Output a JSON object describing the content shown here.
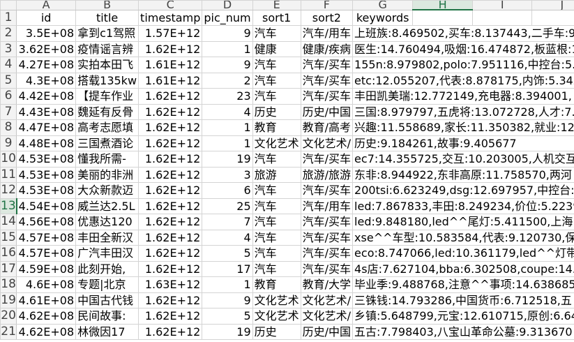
{
  "columns": [
    "A",
    "B",
    "C",
    "D",
    "E",
    "F",
    "G",
    "H",
    "I",
    "J"
  ],
  "selected_column": "H",
  "header_row": {
    "row_num": "1",
    "id": "id",
    "title": "title",
    "timestamp": "timestamp",
    "pic_num": "pic_num",
    "sort1": "sort1",
    "sort2": "sort2",
    "keywords": "keywords"
  },
  "rows": [
    {
      "row_num": "2",
      "id": "3.5E+08",
      "title": "拿到c1驾照",
      "timestamp": "1.57E+12",
      "pic_num": "9",
      "sort1": "汽车",
      "sort2": "汽车/用车",
      "keywords": "上班族:8.469502,买车:8.137443,二手车:9."
    },
    {
      "row_num": "3",
      "id": "3.62E+08",
      "title": "疫情谣言辨",
      "timestamp": "1.62E+12",
      "pic_num": "1",
      "sort1": "健康",
      "sort2": "健康/疾病",
      "keywords": "医生:14.760494,吸烟:16.474872,板蓝根:1"
    },
    {
      "row_num": "4",
      "id": "4.27E+08",
      "title": "实拍本田飞",
      "timestamp": "1.61E+12",
      "pic_num": "9",
      "sort1": "汽车",
      "sort2": "汽车/买车",
      "keywords": "155n:8.979802,polo:7.951116,中控台:5.9"
    },
    {
      "row_num": "5",
      "id": "4.3E+08",
      "title": "搭载135kw",
      "timestamp": "1.61E+12",
      "pic_num": "2",
      "sort1": "汽车",
      "sort2": "汽车/买车",
      "keywords": "etc:12.055207,代表:8.878175,内饰:5.3420"
    },
    {
      "row_num": "6",
      "id": "4.42E+08",
      "title": "【提车作业",
      "timestamp": "1.62E+12",
      "pic_num": "23",
      "sort1": "汽车",
      "sort2": "汽车/买车",
      "keywords": "丰田凯美瑞:12.772149,充电器:8.394001,"
    },
    {
      "row_num": "7",
      "id": "4.43E+08",
      "title": "魏延有反骨",
      "timestamp": "1.62E+12",
      "pic_num": "4",
      "sort1": "历史",
      "sort2": "历史/中国",
      "keywords": "三国:8.979797,五虎将:13.072728,人才:7."
    },
    {
      "row_num": "8",
      "id": "4.47E+08",
      "title": "高考志愿填",
      "timestamp": "1.62E+12",
      "pic_num": "1",
      "sort1": "教育",
      "sort2": "教育/高考",
      "keywords": "兴趣:11.558689,家长:11.350382,就业:12."
    },
    {
      "row_num": "9",
      "id": "4.48E+08",
      "title": "三国煮酒论",
      "timestamp": "1.62E+12",
      "pic_num": "1",
      "sort1": "文化艺术",
      "sort2": "文化艺术/",
      "keywords": "历史:9.184261,故事:9.405677"
    },
    {
      "row_num": "10",
      "id": "4.53E+08",
      "title": "懂我所需-",
      "timestamp": "1.62E+12",
      "pic_num": "19",
      "sort1": "汽车",
      "sort2": "汽车/买车",
      "keywords": "ec7:14.355725,交互:10.203005,人机交互"
    },
    {
      "row_num": "11",
      "id": "4.53E+08",
      "title": "美丽的非洲",
      "timestamp": "1.62E+12",
      "pic_num": "3",
      "sort1": "旅游",
      "sort2": "旅游/旅游",
      "keywords": "东非:8.944922,东非高原:11.758570,两河"
    },
    {
      "row_num": "12",
      "id": "4.53E+08",
      "title": "大众新款迈",
      "timestamp": "1.62E+12",
      "pic_num": "6",
      "sort1": "汽车",
      "sort2": "汽车/买车",
      "keywords": "200tsi:6.623249,dsg:12.697957,中控台:8."
    },
    {
      "row_num": "13",
      "id": "4.54E+08",
      "title": "威兰达2.5L",
      "timestamp": "1.62E+12",
      "pic_num": "25",
      "sort1": "汽车",
      "sort2": "汽车/用车",
      "keywords": "led:7.867833,丰田:8.249234,价位:5.22396"
    },
    {
      "row_num": "14",
      "id": "4.56E+08",
      "title": "优惠达120",
      "timestamp": "1.62E+12",
      "pic_num": "7",
      "sort1": "汽车",
      "sort2": "汽车/买车",
      "keywords": "led:9.848180,led^^尾灯:5.411500,上海:7."
    },
    {
      "row_num": "15",
      "id": "4.57E+08",
      "title": "丰田全新汉",
      "timestamp": "1.62E+12",
      "pic_num": "4",
      "sort1": "汽车",
      "sort2": "汽车/买车",
      "keywords": "xse^^车型:10.583584,代表:9.120730,保险"
    },
    {
      "row_num": "16",
      "id": "4.57E+08",
      "title": "广汽丰田汉",
      "timestamp": "1.62E+12",
      "pic_num": "5",
      "sort1": "汽车",
      "sort2": "汽车/买车",
      "keywords": "eco:8.747066,led:10.361179,led^^灯带:1"
    },
    {
      "row_num": "17",
      "id": "4.59E+08",
      "title": "此刻开始,",
      "timestamp": "1.62E+12",
      "pic_num": "17",
      "sort1": "汽车",
      "sort2": "汽车/买车",
      "keywords": "4s店:7.627104,bba:6.302508,coupe:14.00"
    },
    {
      "row_num": "18",
      "id": "4.6E+08",
      "title": "专题|北京",
      "timestamp": "1.63E+12",
      "pic_num": "1",
      "sort1": "教育",
      "sort2": "教育/大学",
      "keywords": "毕业季:9.488768,注意^^事项:14.638685"
    },
    {
      "row_num": "19",
      "id": "4.61E+08",
      "title": "中国古代钱",
      "timestamp": "1.62E+12",
      "pic_num": "9",
      "sort1": "文化艺术",
      "sort2": "文化艺术/",
      "keywords": "三铢钱:14.793286,中国货币:6.712518,五"
    },
    {
      "row_num": "20",
      "id": "4.62E+08",
      "title": "民间故事:",
      "timestamp": "1.62E+12",
      "pic_num": "5",
      "sort1": "文化艺术",
      "sort2": "文化艺术/",
      "keywords": "乡镇:5.648799,元宝:12.610715,原创:6.64"
    },
    {
      "row_num": "21",
      "id": "4.62E+08",
      "title": "林微因17",
      "timestamp": "1.62E+12",
      "pic_num": "19",
      "sort1": "历史",
      "sort2": "历史/中国",
      "keywords": "五古:7.798403,八宝山革命公墓:9.313670"
    }
  ]
}
